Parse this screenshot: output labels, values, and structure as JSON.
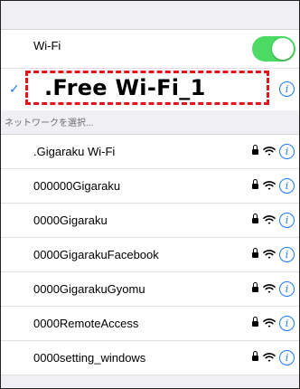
{
  "wifi": {
    "label": "Wi-Fi",
    "enabled": true,
    "toggle_color": "#4cd964",
    "connected_network": ".Free Wi-Fi_1",
    "checkmark": "✓",
    "info_glyph": "i"
  },
  "networks_section": {
    "header": "ネットワークを選択...",
    "items": [
      {
        "name": ".Gigaraku Wi-Fi",
        "secured": true
      },
      {
        "name": "000000Gigaraku",
        "secured": true
      },
      {
        "name": "0000Gigaraku",
        "secured": true
      },
      {
        "name": "0000GigarakuFacebook",
        "secured": true
      },
      {
        "name": "0000GigarakuGyomu",
        "secured": true
      },
      {
        "name": "0000RemoteAccess",
        "secured": true
      },
      {
        "name": "0000setting_windows",
        "secured": true
      }
    ]
  },
  "colors": {
    "accent_blue": "#1a7bf0",
    "highlight_red": "#e5141a",
    "background": "#efeff4"
  }
}
